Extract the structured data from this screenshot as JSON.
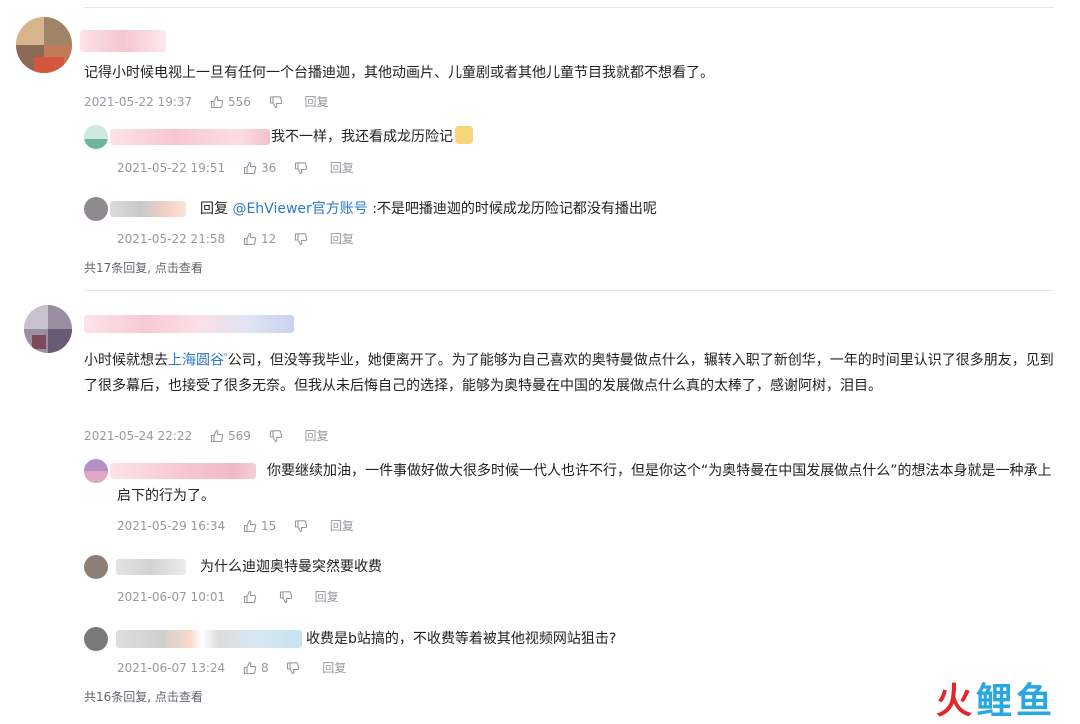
{
  "threads": [
    {
      "comment": {
        "text": "记得小时候电视上一旦有任何一个台播迪迦，其他动画片、儿童剧或者其他儿童节目我就都不想看了。",
        "date": "2021-05-22 19:37",
        "likes": "556",
        "reply_label": "回复"
      },
      "replies": [
        {
          "text": "我不一样，我还看成龙历险记",
          "date": "2021-05-22 19:51",
          "likes": "36",
          "reply_label": "回复"
        },
        {
          "prefix": "回复 ",
          "mention": "@EhViewer官方账号",
          "text": " :不是吧播迪迦的时候成龙历险记都没有播出呢",
          "date": "2021-05-22 21:58",
          "likes": "12",
          "reply_label": "回复"
        }
      ],
      "more": "共17条回复, 点击查看"
    },
    {
      "comment": {
        "text_before": "小时候就想去",
        "link": "上海圆谷",
        "text_after": "公司，但没等我毕业，她便离开了。为了能够为自己喜欢的奥特曼做点什么，辗转入职了新创华，一年的时间里认识了很多朋友，见到了很多幕后，也接受了很多无奈。但我从未后悔自己的选择，能够为奥特曼在中国的发展做点什么真的太棒了，感谢阿树，泪目。",
        "date": "2021-05-24 22:22",
        "likes": "569",
        "reply_label": "回复"
      },
      "replies": [
        {
          "text": "你要继续加油，一件事做好做大很多时候一代人也许不行，但是你这个“为奥特曼在中国发展做点什么”的想法本身就是一种承上启下的行为了。",
          "date": "2021-05-29 16:34",
          "likes": "15",
          "reply_label": "回复"
        },
        {
          "text": "为什么迪迦奥特曼突然要收费",
          "date": "2021-06-07 10:01",
          "likes": "",
          "reply_label": "回复"
        },
        {
          "text": "收费是b站搞的，不收费等着被其他视频网站狙击?",
          "date": "2021-06-07 13:24",
          "likes": "8",
          "reply_label": "回复"
        }
      ],
      "more": "共16条回复, 点击查看"
    }
  ],
  "watermark": {
    "fire": "火",
    "rest": "鲤鱼"
  },
  "icons": {
    "like": "thumbs-up-icon",
    "dislike": "thumbs-down-icon"
  }
}
